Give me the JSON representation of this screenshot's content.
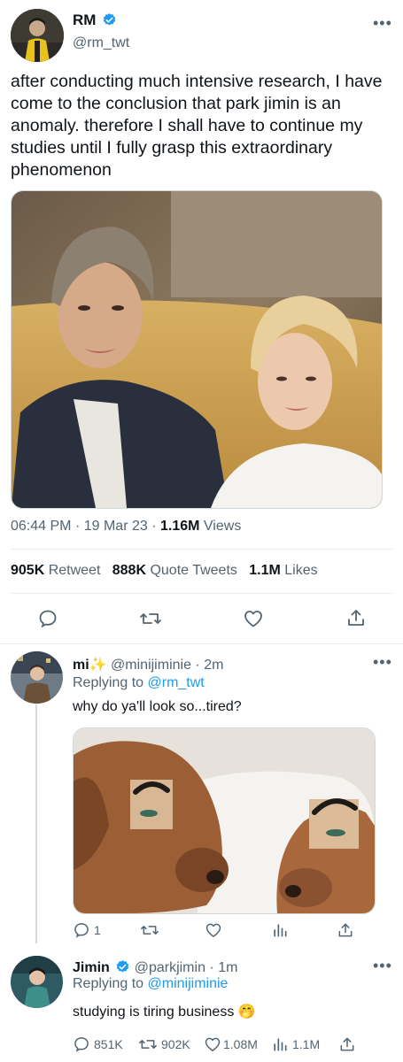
{
  "main_tweet": {
    "name": "RM",
    "handle": "@rm_twt",
    "text": "after conducting much intensive research, I have come to the conclusion that park jimin is an anomaly. therefore I shall have to continue my studies until I fully grasp this extraordinary phenomenon",
    "time": "06:44 PM",
    "sep": "·",
    "date": "19 Mar 23",
    "views_count": "1.16M",
    "views_label": "Views",
    "retweets_count": "905K",
    "retweets_label": "Retweet",
    "quotes_count": "888K",
    "quotes_label": "Quote Tweets",
    "likes_count": "1.1M",
    "likes_label": "Likes"
  },
  "reply1": {
    "name": "mi",
    "name_emoji": "✨",
    "handle": "@minijiminie",
    "sep": "·",
    "time": "2m",
    "replying_prefix": "Replying to",
    "replying_to": "@rm_twt",
    "text": "why do ya'll look so...tired?",
    "reply_count": "1"
  },
  "reply2": {
    "name": "Jimin",
    "handle": "@parkjimin",
    "sep": "·",
    "time": "1m",
    "replying_prefix": "Replying to",
    "replying_to": "@minijiminie",
    "text": "studying is tiring business 🤭",
    "reply_count": "851K",
    "retweet_count": "902K",
    "like_count": "1.08M",
    "views_count": "1.1M"
  },
  "icons": {
    "more": "more-icon",
    "verified": "verified-badge-icon",
    "reply": "reply-icon",
    "retweet": "retweet-icon",
    "like": "heart-icon",
    "share": "share-icon",
    "views": "views-icon"
  },
  "colors": {
    "accent": "#1d9bf0",
    "muted": "#536471",
    "text": "#0f1419"
  }
}
